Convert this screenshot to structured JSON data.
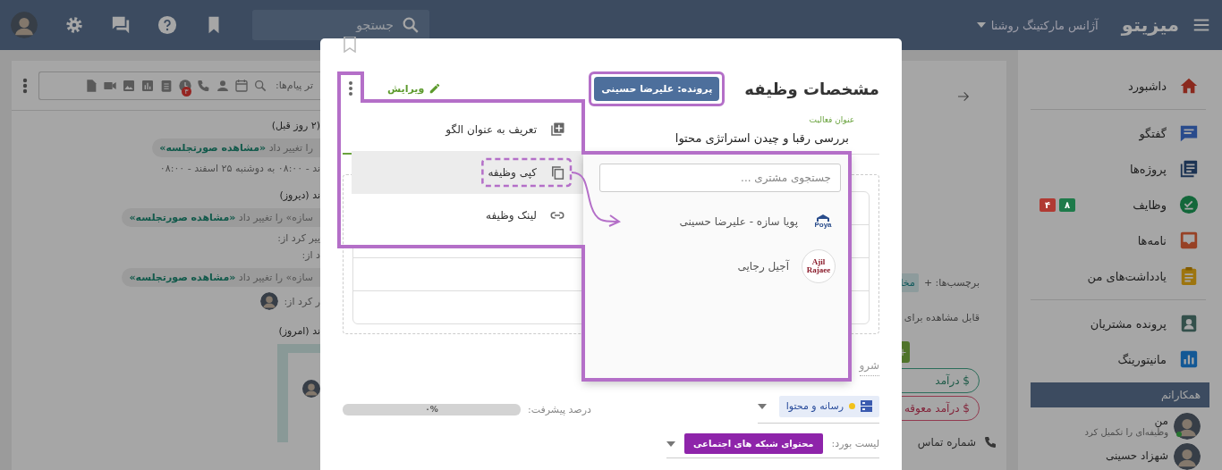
{
  "top_bar": {
    "brand": "میزیتو",
    "company": "آژانس مارکتینگ روشنا",
    "search": {
      "placeholder": "جستجو"
    }
  },
  "sidebar": {
    "sections": [
      {
        "items": [
          {
            "label": "داشبورد",
            "kind": "home"
          }
        ]
      },
      {
        "items": [
          {
            "label": "گفتگو",
            "kind": "chat"
          },
          {
            "label": "پروژه‌ها",
            "kind": "projects"
          },
          {
            "label": "وظایف",
            "kind": "tasks",
            "badges": [
              {
                "text": "۸",
                "color": "#1e7a4a"
              },
              {
                "text": "۴",
                "color": "#b03a33"
              }
            ]
          },
          {
            "label": "نامه‌ها",
            "kind": "mail"
          },
          {
            "label": "یادداشت‌های من",
            "kind": "notes"
          }
        ]
      },
      {
        "items": [
          {
            "label": "پرونده مشتریان",
            "kind": "customers"
          },
          {
            "label": "مانیتورینگ",
            "kind": "monitor"
          }
        ]
      }
    ],
    "colleagues": {
      "title": "همکارانم",
      "people": [
        {
          "name": "من",
          "activity": "وظیفه‌ای را تکمیل کرد",
          "online": true
        },
        {
          "name": "شهزاد حسینی",
          "online": false
        }
      ]
    }
  },
  "details_panel": {
    "tags_label": "برچسب‌ها: +",
    "tag": "مخا",
    "visibility": "قابل مشاهده برای",
    "add_button": "+",
    "income": "$ درآمد",
    "overdue_income": "$ درآمد معوقه",
    "phone": "شماره تماس"
  },
  "chat": {
    "filter_placeholder": "تر پیام‌ها:",
    "badge": "۳",
    "entries": [
      {
        "kind": "date",
        "text": "(۲ روز قبل)"
      },
      {
        "kind": "change",
        "text": "را تغییر داد **«مشاهده صورتجلسه»**"
      },
      {
        "kind": "line",
        "text": "ند - ۰۸:۰۰ به دوشنبه ۲۵ اسفند - ۰۸:۰۰"
      },
      {
        "kind": "date",
        "text": "ند (دیروز)"
      },
      {
        "kind": "change",
        "text": "سازه» را تغییر داد **«مشاهده صورتجلسه»**"
      },
      {
        "kind": "line",
        "text": "ییر کرد از:"
      },
      {
        "kind": "line",
        "text": "د از:"
      },
      {
        "kind": "change",
        "text": "سازه» را تغییر داد **«مشاهده صورتجلسه»**"
      },
      {
        "kind": "person_line",
        "text": "ر کرد از:"
      },
      {
        "kind": "date",
        "text": "ند (امروز)"
      },
      {
        "kind": "card"
      }
    ]
  },
  "modal": {
    "title": "مشخصات وظیفه",
    "owner_button": "پرونده: علیرضا حسینی",
    "edit": "ویرایش",
    "field_label": "عنوان فعالیت",
    "field_value": "بررسی رقبا و چیدن استراتژی محتوا",
    "start_label": "شرو",
    "progress": {
      "label": "درصد پیشرفت:",
      "text": "۰%",
      "level": 0
    },
    "board": {
      "name": "رسانه و محتوا",
      "color": "#f2c21b"
    },
    "board_list": {
      "label": "لیست بورد:",
      "value": "محتوای شبکه های اجتماعی"
    },
    "menu": [
      {
        "label": "تعریف به عنوان الگو",
        "kind": "template",
        "selected": false
      },
      {
        "label": "کپی وظیفه",
        "kind": "copy",
        "selected": true
      },
      {
        "label": "لینک وظیفه",
        "kind": "link",
        "selected": false
      }
    ],
    "customer_popup": {
      "search": {
        "placeholder": "جستجوی مشتری ..."
      },
      "customers": [
        {
          "name": "پویا سازه - علیرضا حسینی",
          "logo_text": "Poya",
          "kind": "poya"
        },
        {
          "name": "آجیل رجایی",
          "logo_text": "Ajil Rajaee",
          "kind": "ajil"
        }
      ]
    }
  }
}
